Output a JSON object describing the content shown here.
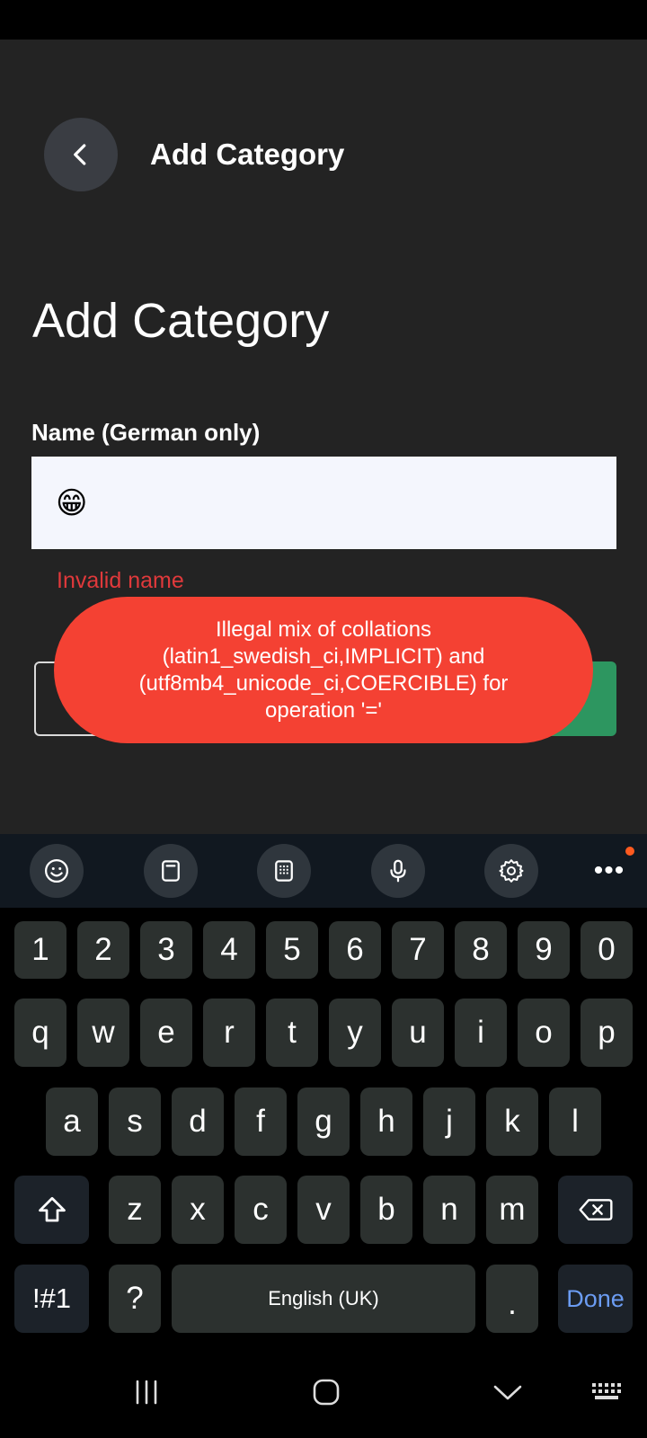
{
  "header": {
    "title": "Add Category"
  },
  "page": {
    "title": "Add Category"
  },
  "form": {
    "name_label": "Name (German only)",
    "name_value": "😁",
    "error": "Invalid name"
  },
  "toast": {
    "message": "Illegal mix of collations (latin1_swedish_ci,IMPLICIT) and (utf8mb4_unicode_ci,COERCIBLE) for operation '='"
  },
  "keyboard_toolbar": {
    "items": [
      "emoji-icon",
      "clipboard-icon",
      "keypad-icon",
      "microphone-icon",
      "settings-icon",
      "more-icon"
    ],
    "more_glyph": "•••"
  },
  "keyboard": {
    "row_numbers": [
      "1",
      "2",
      "3",
      "4",
      "5",
      "6",
      "7",
      "8",
      "9",
      "0"
    ],
    "row_q": [
      "q",
      "w",
      "e",
      "r",
      "t",
      "y",
      "u",
      "i",
      "o",
      "p"
    ],
    "row_a": [
      "a",
      "s",
      "d",
      "f",
      "g",
      "h",
      "j",
      "k",
      "l"
    ],
    "row_z": [
      "z",
      "x",
      "c",
      "v",
      "b",
      "n",
      "m"
    ],
    "symbols_label": "!#1",
    "question_label": "?",
    "space_label": "English (UK)",
    "period_label": ".",
    "done_label": "Done"
  },
  "colors": {
    "app_background": "#232323",
    "error_red": "#e0393b",
    "toast_red": "#f44133",
    "primary_green": "#2d9660",
    "done_blue": "#6b9cf2"
  }
}
